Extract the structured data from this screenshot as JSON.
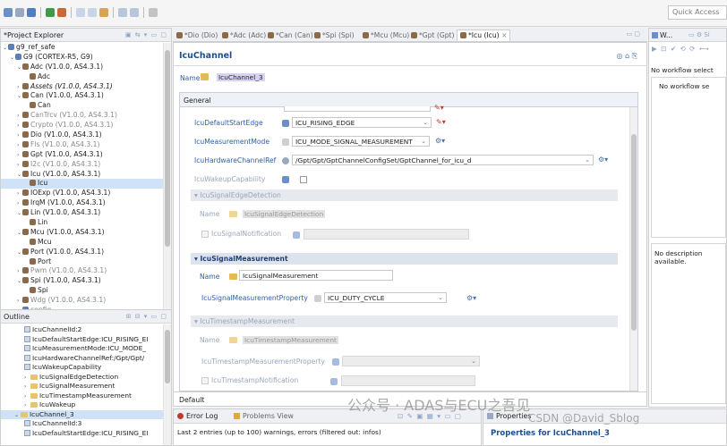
{
  "toolbar": {
    "quick_access": "Quick Access"
  },
  "project_explorer": {
    "title": "*Project Explorer",
    "items": [
      {
        "label": "g9_ref_safe",
        "indent": 0,
        "exp": "v",
        "icon": "proj"
      },
      {
        "label": "G9 (CORTEX-R5, G9)",
        "indent": 1,
        "exp": "v",
        "icon": "proj"
      },
      {
        "label": "Adc (V1.0.0, AS4.3.1)",
        "indent": 2,
        "exp": "v",
        "icon": "mod"
      },
      {
        "label": "Adc",
        "indent": 3,
        "exp": "",
        "icon": "mod"
      },
      {
        "label": "Assets (V1.0.0, AS4.3.1)",
        "indent": 2,
        "exp": ">",
        "icon": "mod",
        "italic": true
      },
      {
        "label": "Can (V1.0.0, AS4.3.1)",
        "indent": 2,
        "exp": "v",
        "icon": "mod"
      },
      {
        "label": "Can",
        "indent": 3,
        "exp": "",
        "icon": "mod"
      },
      {
        "label": "CanTrcv (V1.0.0, AS4.3.1)",
        "indent": 2,
        "exp": ">",
        "icon": "mod",
        "dim": true
      },
      {
        "label": "Crypto (V1.0.0, AS4.3.1)",
        "indent": 2,
        "exp": ">",
        "icon": "mod",
        "dim": true
      },
      {
        "label": "Dio (V1.0.0, AS4.3.1)",
        "indent": 2,
        "exp": ">",
        "icon": "mod"
      },
      {
        "label": "Fls (V1.0.0, AS4.3.1)",
        "indent": 2,
        "exp": ">",
        "icon": "mod",
        "dim": true
      },
      {
        "label": "Gpt (V1.0.0, AS4.3.1)",
        "indent": 2,
        "exp": ">",
        "icon": "mod"
      },
      {
        "label": "I2c (V1.0.0, AS4.3.1)",
        "indent": 2,
        "exp": ">",
        "icon": "mod",
        "dim": true
      },
      {
        "label": "Icu (V1.0.0, AS4.3.1)",
        "indent": 2,
        "exp": "v",
        "icon": "mod"
      },
      {
        "label": "Icu",
        "indent": 3,
        "exp": "",
        "icon": "mod",
        "sel": true
      },
      {
        "label": "IOExp (V1.0.0, AS4.3.1)",
        "indent": 2,
        "exp": ">",
        "icon": "mod"
      },
      {
        "label": "IrqM (V1.0.0, AS4.3.1)",
        "indent": 2,
        "exp": ">",
        "icon": "mod"
      },
      {
        "label": "Lin (V1.0.0, AS4.3.1)",
        "indent": 2,
        "exp": "v",
        "icon": "mod"
      },
      {
        "label": "Lin",
        "indent": 3,
        "exp": "",
        "icon": "mod"
      },
      {
        "label": "Mcu (V1.0.0, AS4.3.1)",
        "indent": 2,
        "exp": "v",
        "icon": "mod"
      },
      {
        "label": "Mcu",
        "indent": 3,
        "exp": "",
        "icon": "mod"
      },
      {
        "label": "Port (V1.0.0, AS4.3.1)",
        "indent": 2,
        "exp": "v",
        "icon": "mod"
      },
      {
        "label": "Port",
        "indent": 3,
        "exp": "",
        "icon": "mod"
      },
      {
        "label": "Pwm (V1.0.0, AS4.3.1)",
        "indent": 2,
        "exp": ">",
        "icon": "mod",
        "dim": true
      },
      {
        "label": "Spi (V1.0.0, AS4.3.1)",
        "indent": 2,
        "exp": "v",
        "icon": "mod"
      },
      {
        "label": "Spi",
        "indent": 3,
        "exp": "",
        "icon": "mod"
      },
      {
        "label": "Wdg (V1.0.0, AS4.3.1)",
        "indent": 2,
        "exp": ">",
        "icon": "mod",
        "dim": true
      },
      {
        "label": "config",
        "indent": 2,
        "exp": ">",
        "icon": "proj",
        "dim": true
      }
    ]
  },
  "outline": {
    "title": "Outline",
    "items": [
      {
        "label": "IcuChannelId:2",
        "indent": 2,
        "kind": "attr"
      },
      {
        "label": "IcuDefaultStartEdge:ICU_RISING_EI",
        "indent": 2,
        "kind": "attr"
      },
      {
        "label": "IcuMeasurementMode:ICU_MODE_",
        "indent": 2,
        "kind": "attr"
      },
      {
        "label": "IcuHardwareChannelRef:/Gpt/Gpt/",
        "indent": 2,
        "kind": "attr"
      },
      {
        "label": "IcuWakeupCapability",
        "indent": 2,
        "kind": "attr"
      },
      {
        "label": "IcuSignalEdgeDetection",
        "indent": 2,
        "kind": "folder",
        "exp": ">"
      },
      {
        "label": "IcuSignalMeasurement",
        "indent": 2,
        "kind": "folder",
        "exp": ">"
      },
      {
        "label": "IcuTimestampMeasurement",
        "indent": 2,
        "kind": "folder",
        "exp": ">"
      },
      {
        "label": "IcuWakeup",
        "indent": 2,
        "kind": "folder",
        "exp": ">"
      },
      {
        "label": "IcuChannel_3",
        "indent": 1,
        "kind": "folder",
        "exp": "v",
        "sel": true
      },
      {
        "label": "IcuChannelId:3",
        "indent": 2,
        "kind": "attr"
      },
      {
        "label": "IcuDefaultStartEdge:ICU_RISING_EI",
        "indent": 2,
        "kind": "attr"
      }
    ]
  },
  "editor_tabs": [
    {
      "label": "*Dio (Dio)"
    },
    {
      "label": "*Adc (Adc)"
    },
    {
      "label": "*Can (Can)"
    },
    {
      "label": "*Spi (Spi)"
    },
    {
      "label": "*Mcu (Mcu)"
    },
    {
      "label": "*Gpt (Gpt)"
    },
    {
      "label": "*Icu (Icu)",
      "active": true
    }
  ],
  "editor": {
    "header": "IcuChannel",
    "name_label": "Name",
    "name_value": "IcuChannel_3",
    "section_tab": "General",
    "bottom_tab": "Default",
    "fields": {
      "default_start_edge": {
        "label": "IcuDefaultStartEdge",
        "value": "ICU_RISING_EDGE"
      },
      "measurement_mode": {
        "label": "IcuMeasurementMode",
        "value": "ICU_MODE_SIGNAL_MEASUREMENT"
      },
      "hardware_channel_ref": {
        "label": "IcuHardwareChannelRef",
        "value": "/Gpt/Gpt/GptChannelConfigSet/GptChannel_for_icu_d"
      },
      "wakeup_capability": {
        "label": "IcuWakeupCapability"
      }
    },
    "signal_edge_detection": {
      "title": "IcuSignalEdgeDetection",
      "name_label": "Name",
      "name_value": "IcuSignalEdgeDetection",
      "notification_label": "IcuSignalNotification"
    },
    "signal_measurement": {
      "title": "IcuSignalMeasurement",
      "name_label": "Name",
      "name_value": "IcuSignalMeasurement",
      "property_label": "IcuSignalMeasurementProperty",
      "property_value": "ICU_DUTY_CYCLE"
    },
    "timestamp_measurement": {
      "title": "IcuTimestampMeasurement",
      "name_label": "Name",
      "name_value": "IcuTimestampMeasurement",
      "property_label": "IcuTimestampMeasurementProperty",
      "notification_label": "IcuTimestampNotification"
    }
  },
  "problems": {
    "error_log_tab": "Error Log",
    "problems_tab": "Problems View",
    "status": "Last 2 entries (up to 100) warnings, errors (filtered out: infos)"
  },
  "properties": {
    "tab": "Properties",
    "title": "Properties for IcuChannel_3"
  },
  "workflow": {
    "tab": "W...",
    "msg1": "No workflow select",
    "msg2": "No workflow se",
    "description": "No description available."
  },
  "watermark": {
    "text1": "公众号 · ADAS与ECU之吾见",
    "text2": "CSDN @David_Sblog"
  }
}
